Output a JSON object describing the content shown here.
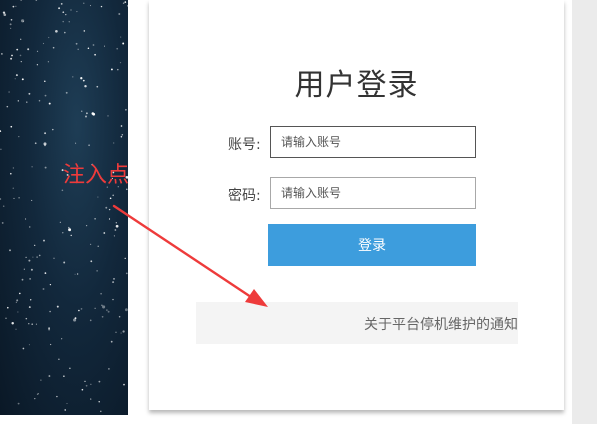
{
  "login": {
    "title": "用户登录",
    "username_label": "账号:",
    "username_placeholder": "请输入账号",
    "password_label": "密码:",
    "password_placeholder": "请输入账号",
    "submit_label": "登录"
  },
  "notice": {
    "text": "关于平台停机维护的通知"
  },
  "annotation": {
    "text": "注入点"
  },
  "colors": {
    "accent": "#3d9ddd",
    "annotation": "#ee3b3b",
    "sky": "#12283c"
  },
  "icons": [
    "starry-sky-image",
    "annotation-arrow-icon"
  ]
}
